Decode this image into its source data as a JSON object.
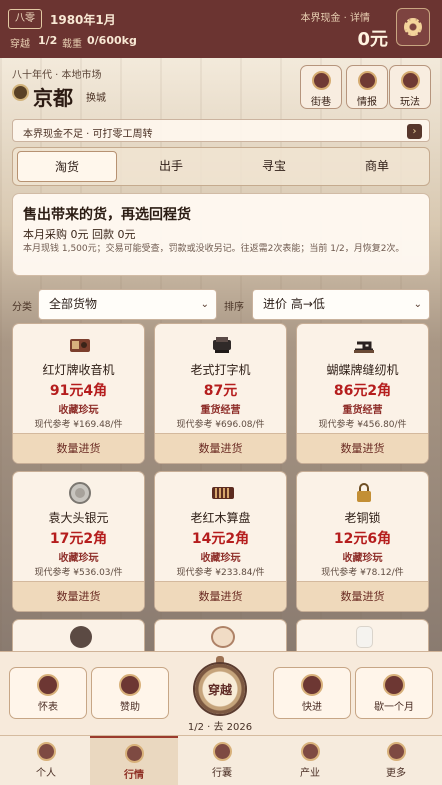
{
  "header": {
    "era_tag": "八零",
    "date": "1980年1月",
    "crossing_label": "穿越",
    "crossing_value": "1/2",
    "load_label": "载重",
    "load_value": "0/600kg",
    "cash_label": "本界现金 · 详情",
    "cash_value": "0元",
    "settings_icon": "gear-icon"
  },
  "location": {
    "subtitle": "八十年代 · 本地市场",
    "city": "京都",
    "switch_label": "换城"
  },
  "top_actions": [
    {
      "label": "街巷",
      "icon": "people-icon"
    },
    {
      "label": "情报",
      "icon": "megaphone-icon"
    },
    {
      "label": "玩法",
      "icon": "lightbulb-icon"
    }
  ],
  "notice": {
    "text": "本界现金不足 · 可打零工周转",
    "arrow": "›"
  },
  "tabs": [
    {
      "label": "淘货",
      "active": true
    },
    {
      "label": "出手",
      "active": false
    },
    {
      "label": "寻宝",
      "active": false
    },
    {
      "label": "商单",
      "active": false
    }
  ],
  "info": {
    "title": "售出带来的货，再选回程货",
    "monthly": "本月采购 0元    回款 0元",
    "rule": "本月现钱 1,500元；交易可能受查，罚款或没收另记。往返需2次表能；当前 1/2，月恢复2次。"
  },
  "filters": {
    "category_label": "分类",
    "category_value": "全部货物",
    "sort_label": "排序",
    "sort_value": "进价 高→低"
  },
  "products": [
    {
      "name": "红灯牌收音机",
      "price": "91元4角",
      "tag": "收藏珍玩",
      "ref": "现代参考 ¥169.48/件",
      "button": "数量进货",
      "icon": "radio-icon"
    },
    {
      "name": "老式打字机",
      "price": "87元",
      "tag": "重货经营",
      "ref": "现代参考 ¥696.08/件",
      "button": "数量进货",
      "icon": "typewriter-icon"
    },
    {
      "name": "蝴蝶牌缝纫机",
      "price": "86元2角",
      "tag": "重货经营",
      "ref": "现代参考 ¥456.80/件",
      "button": "数量进货",
      "icon": "sewing-machine-icon"
    },
    {
      "name": "袁大头银元",
      "price": "17元2角",
      "tag": "收藏珍玩",
      "ref": "现代参考 ¥536.03/件",
      "button": "数量进货",
      "icon": "coin-icon"
    },
    {
      "name": "老红木算盘",
      "price": "14元2角",
      "tag": "收藏珍玩",
      "ref": "现代参考 ¥233.84/件",
      "button": "数量进货",
      "icon": "abacus-icon"
    },
    {
      "name": "老铜锁",
      "price": "12元6角",
      "tag": "收藏珍玩",
      "ref": "现代参考 ¥78.12/件",
      "button": "数量进货",
      "icon": "lock-icon"
    }
  ],
  "bottom_dock": {
    "left_buttons": [
      {
        "label": "怀表",
        "icon": "clock-icon"
      },
      {
        "label": "赞助",
        "icon": "gift-icon"
      }
    ],
    "watch_label": "穿越",
    "watch_caption": "1/2 · 去 2026",
    "right_buttons": [
      {
        "label": "快进",
        "icon": "fast-forward-icon"
      },
      {
        "label": "歇一个月",
        "icon": "rest-icon"
      }
    ]
  },
  "nav": [
    {
      "label": "个人",
      "active": false,
      "icon": "person-icon"
    },
    {
      "label": "行情",
      "active": true,
      "icon": "chart-icon"
    },
    {
      "label": "行囊",
      "active": false,
      "icon": "bag-icon"
    },
    {
      "label": "产业",
      "active": false,
      "icon": "building-icon"
    },
    {
      "label": "更多",
      "active": false,
      "icon": "grid-icon"
    }
  ],
  "colors": {
    "header_bg": "#6b3431",
    "accent_red": "#b51d1d",
    "card_bg": "#fbf2e7",
    "button_bg": "#efd9bb"
  }
}
